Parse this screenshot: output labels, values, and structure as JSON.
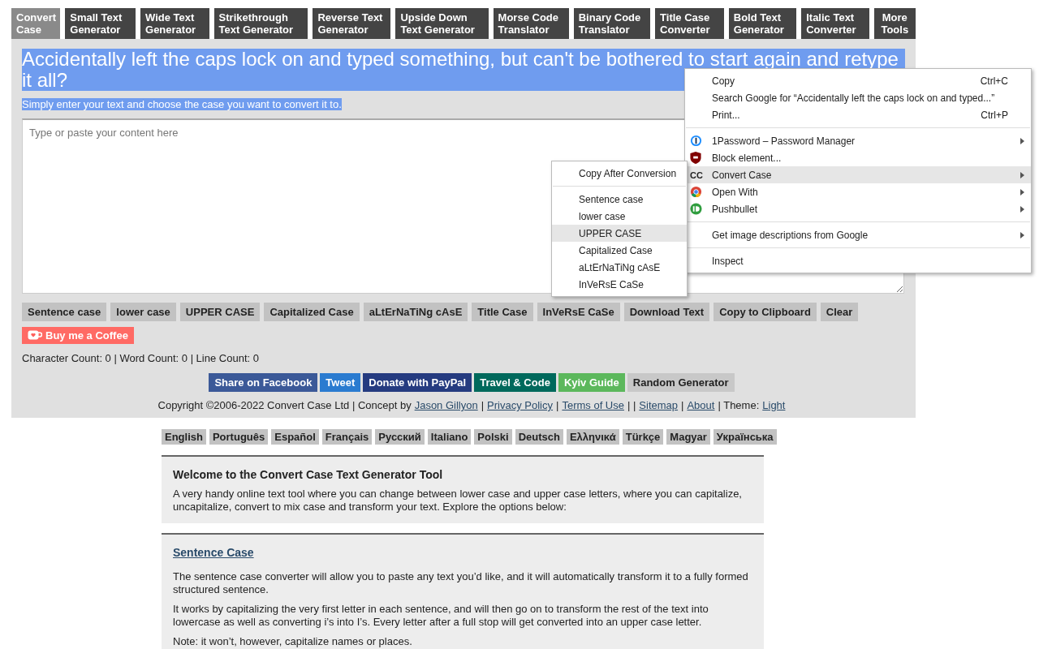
{
  "nav": [
    {
      "label": "Convert Case",
      "selected": true
    },
    {
      "label": "Small Text Generator",
      "selected": false
    },
    {
      "label": "Wide Text Generator",
      "selected": false
    },
    {
      "label": "Strikethrough Text Generator",
      "selected": false
    },
    {
      "label": "Reverse Text Generator",
      "selected": false
    },
    {
      "label": "Upside Down Text Generator",
      "selected": false
    },
    {
      "label": "Morse Code Translator",
      "selected": false
    },
    {
      "label": "Binary Code Translator",
      "selected": false
    },
    {
      "label": "Title Case Converter",
      "selected": false
    },
    {
      "label": "Bold Text Generator",
      "selected": false
    },
    {
      "label": "Italic Text Converter",
      "selected": false
    },
    {
      "label": "More Tools",
      "selected": false
    }
  ],
  "intro": {
    "heading": "Accidentally left the caps lock on and typed something, but can't be bothered to start again and retype it all?",
    "subtitle": "Simply enter your text and choose the case you want to convert it to.",
    "text_selected": true
  },
  "editor": {
    "placeholder": "Type or paste your content here"
  },
  "actions": [
    "Sentence case",
    "lower case",
    "UPPER CASE",
    "Capitalized Case",
    "aLtErNaTiNg cAsE",
    "Title Case",
    "InVeRsE CaSe",
    "Download Text",
    "Copy to Clipboard",
    "Clear"
  ],
  "coffee": "Buy me a Coffee",
  "counts": "Character Count: 0 | Word Count: 0 | Line Count: 0",
  "share": [
    {
      "label": "Share on Facebook",
      "color": "#3b5998"
    },
    {
      "label": "Tweet",
      "color": "#2a7bd0"
    },
    {
      "label": "Donate with PayPal",
      "color": "#253b80"
    },
    {
      "label": "Travel & Code",
      "color": "#00695c"
    },
    {
      "label": "Kyiv Guide",
      "color": "#5cb85c"
    },
    {
      "label": "Random Generator",
      "color": "#c8c8c8"
    }
  ],
  "footer": [
    {
      "kind": "text",
      "text": "Copyright ©2006-2022 Convert Case Ltd | Concept by"
    },
    {
      "kind": "link",
      "text": "Jason Gillyon"
    },
    {
      "kind": "text",
      "text": "|"
    },
    {
      "kind": "link",
      "text": "Privacy Policy"
    },
    {
      "kind": "text",
      "text": "|"
    },
    {
      "kind": "link",
      "text": "Terms of Use"
    },
    {
      "kind": "text",
      "text": "| |"
    },
    {
      "kind": "link",
      "text": "Sitemap"
    },
    {
      "kind": "text",
      "text": "|"
    },
    {
      "kind": "link",
      "text": "About"
    },
    {
      "kind": "text",
      "text": "| Theme:"
    },
    {
      "kind": "link",
      "text": "Light"
    }
  ],
  "languages": [
    "English",
    "Português",
    "Español",
    "Français",
    "Русский",
    "Italiano",
    "Polski",
    "Deutsch",
    "Ελληνικά",
    "Türkçe",
    "Magyar",
    "Українська"
  ],
  "welcome": {
    "title": "Welcome to the Convert Case Text Generator Tool",
    "text": "A very handy online text tool where you can change between lower case and upper case letters, where you can capitalize, uncapitalize, convert to mix case and transform your text. Explore the options below:"
  },
  "section": {
    "title": "Sentence Case",
    "paragraphs": [
      "The sentence case converter will allow you to paste any text you’d like, and it will automatically transform it to a fully formed structured sentence.",
      "It works by capitalizing the very first letter in each sentence, and will then go on to transform the rest of the text into lowercase as well as converting i’s into I’s. Every letter after a full stop will get converted into an upper case letter.",
      "Note: it won’t, however, capitalize names or places."
    ]
  },
  "context_menu": {
    "groups": [
      [
        {
          "label": "Copy",
          "shortcut": "Ctrl+C",
          "submenu": false,
          "highlighted": false
        },
        {
          "label": "Search Google for “Accidentally left the caps lock on and typed...”",
          "submenu": false,
          "highlighted": false
        },
        {
          "label": "Print...",
          "shortcut": "Ctrl+P",
          "submenu": false,
          "highlighted": false
        }
      ],
      [
        {
          "label": "1Password – Password Manager",
          "kind": "password",
          "submenu": true,
          "highlighted": false
        },
        {
          "label": "Block element...",
          "kind": "shield",
          "submenu": false,
          "highlighted": false
        },
        {
          "label": "Convert Case",
          "kind": "badge",
          "badge": "CC",
          "submenu": true,
          "highlighted": true
        },
        {
          "label": "Open With",
          "kind": "chrome",
          "submenu": true,
          "highlighted": false
        },
        {
          "label": "Pushbullet",
          "kind": "pushbullet",
          "submenu": true,
          "highlighted": false
        }
      ],
      [
        {
          "label": "Get image descriptions from Google",
          "submenu": true,
          "highlighted": false
        }
      ],
      [
        {
          "label": "Inspect",
          "submenu": false,
          "highlighted": false
        }
      ]
    ]
  },
  "submenu": {
    "groups": [
      [
        {
          "label": "Copy After Conversion",
          "highlighted": false
        }
      ],
      [
        {
          "label": "Sentence case",
          "highlighted": false
        },
        {
          "label": "lower case",
          "highlighted": false
        },
        {
          "label": "UPPER CASE",
          "highlighted": true
        },
        {
          "label": "Capitalized Case",
          "highlighted": false
        },
        {
          "label": "aLtErNaTiNg cAsE",
          "highlighted": false
        },
        {
          "label": "InVeRsE CaSe",
          "highlighted": false
        }
      ]
    ]
  }
}
